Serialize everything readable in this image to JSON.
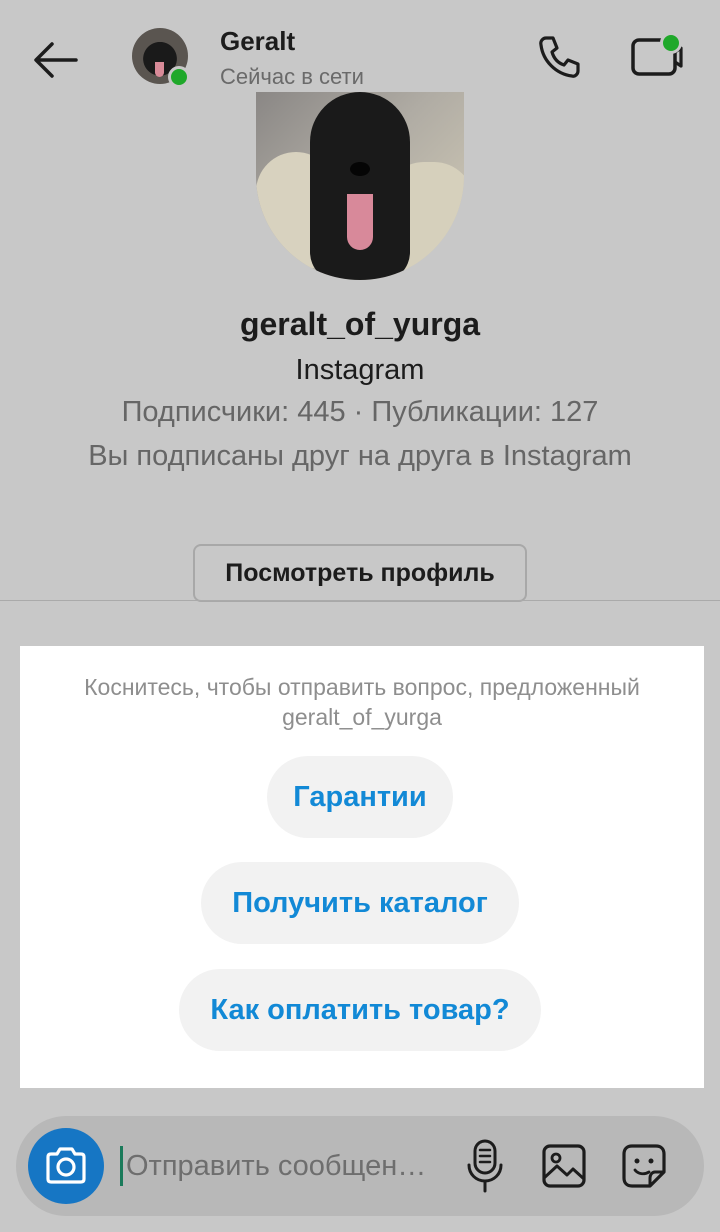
{
  "header": {
    "name": "Geralt",
    "status": "Сейчас в сети",
    "icons": {
      "back": "arrow-left-icon",
      "call": "phone-icon",
      "video": "video-call-icon"
    },
    "online_color": "#1fa82a"
  },
  "profile": {
    "username": "geralt_of_yurga",
    "source": "Instagram",
    "stats": "Подписчики: 445 · Публикации: 127",
    "mutual": "Вы подписаны друг на друга в Instagram",
    "view_button": "Посмотреть профиль"
  },
  "suggestions": {
    "hint": "Коснитесь, чтобы отправить вопрос, предложенный geralt_of_yurga",
    "items": [
      "Гарантии",
      "Получить каталог",
      "Как оплатить товар?"
    ],
    "accent": "#1289d6"
  },
  "composer": {
    "placeholder": "Отправить сообщен…",
    "icons": {
      "camera": "camera-icon",
      "mic": "microphone-icon",
      "gallery": "gallery-icon",
      "sticker": "sticker-icon"
    },
    "camera_color": "#1676c4"
  }
}
